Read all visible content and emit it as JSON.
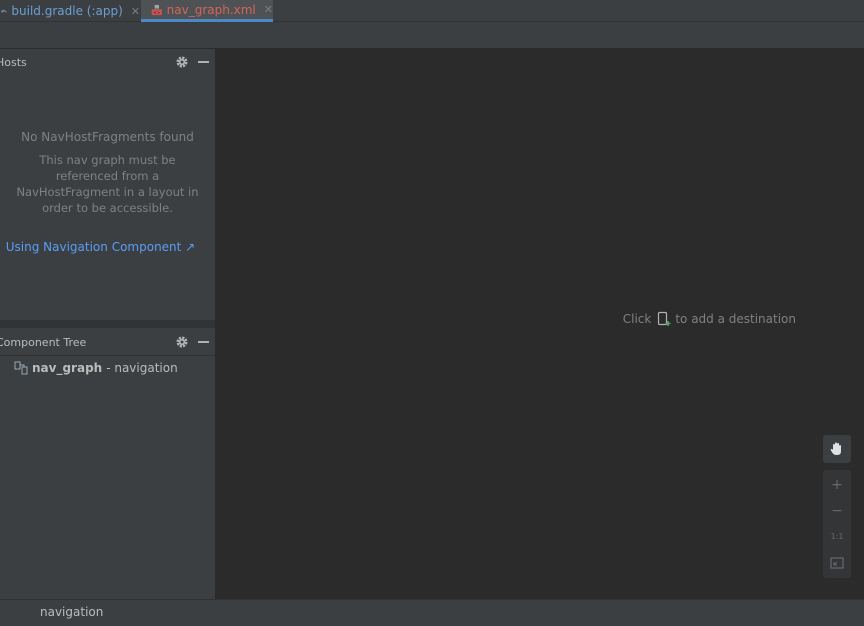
{
  "tabs": [
    {
      "label": "build.gradle (:app)",
      "icon": "gradle-elephant-icon",
      "active": false
    },
    {
      "label": "nav_graph.xml",
      "icon": "navigation-xml-icon",
      "active": true
    }
  ],
  "hosts_panel": {
    "title": "Hosts",
    "empty_title": "No NavHostFragments found",
    "empty_description": "This nav graph must be referenced from a NavHostFragment in a layout in order to be accessible.",
    "link": "Using Navigation Component ↗"
  },
  "component_tree": {
    "title": "Component Tree",
    "root_name": "nav_graph",
    "root_type": "- navigation"
  },
  "canvas": {
    "hint_before": "Click",
    "hint_after": "to add a destination"
  },
  "zoom_controls": {
    "zoom_in": "+",
    "zoom_out": "−",
    "actual_size": "1:1"
  },
  "status": {
    "breadcrumb": "navigation"
  },
  "colors": {
    "accent": "#4a88c7",
    "link": "#589df6",
    "active_tab_text": "#d2655b"
  }
}
